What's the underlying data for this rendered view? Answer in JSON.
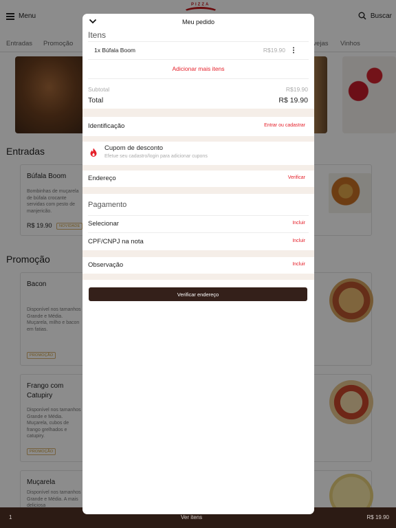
{
  "header": {
    "menu_label": "Menu",
    "search_label": "Buscar",
    "logo_text": "PIZZA"
  },
  "categories": [
    "Entradas",
    "Promoção",
    "Cervejas",
    "Vinhos"
  ],
  "sections": {
    "entradas": {
      "title": "Entradas",
      "items": [
        {
          "name": "Búfala Boom",
          "description": "Bombinhas de muçarela de búfala crocante servidas com pesto de manjericão.",
          "price": "R$ 19.90",
          "tag": "NOVIDADE"
        }
      ]
    },
    "promocao": {
      "title": "Promoção",
      "items": [
        {
          "name": "Bacon",
          "description": "Disponível nos tamanhos Grande e Média. Muçarela, milho e bacon em fatias.",
          "tag": "PROMOÇÃO"
        },
        {
          "name": "Frango com Catupiry",
          "description": "Disponível nos tamanhos Grande e Média. Muçarela, cubos de frango grelhados e catupiry.",
          "tag": "PROMOÇÃO"
        },
        {
          "name": "Muçarela",
          "description": "Disponível nos tamanhos Grande e Média. A mais deliciosa"
        }
      ]
    }
  },
  "bottom_bar": {
    "quantity": "1",
    "view_items": "Ver itens",
    "total": "R$ 19.90"
  },
  "order": {
    "title": "Meu pedido",
    "items_heading": "Itens",
    "line_item": {
      "name": "1x Búfala Boom",
      "price": "R$19.90"
    },
    "add_more": "Adicionar mais itens",
    "subtotal_label": "Subtotal",
    "subtotal_value": "R$19.90",
    "total_label": "Total",
    "total_value": "R$ 19.90",
    "identification_label": "Identificação",
    "identification_action": "Entrar ou cadastrar",
    "coupon_title": "Cupom de desconto",
    "coupon_subtitle": "Efetue seu cadastro/login para adicionar cupons",
    "address_label": "Endereço",
    "address_action": "Verificar",
    "payment_heading": "Pagamento",
    "select_label": "Selecionar",
    "select_action": "Incluir",
    "cpf_label": "CPF/CNPJ na nota",
    "cpf_action": "Incluir",
    "note_label": "Observação",
    "note_action": "Incluir",
    "cta_label": "Verificar endereço"
  },
  "colors": {
    "accent_red": "#e5202a",
    "dark_brown": "#34201a",
    "section_gap": "#f5eee8",
    "tag_gold": "#c8962c"
  }
}
